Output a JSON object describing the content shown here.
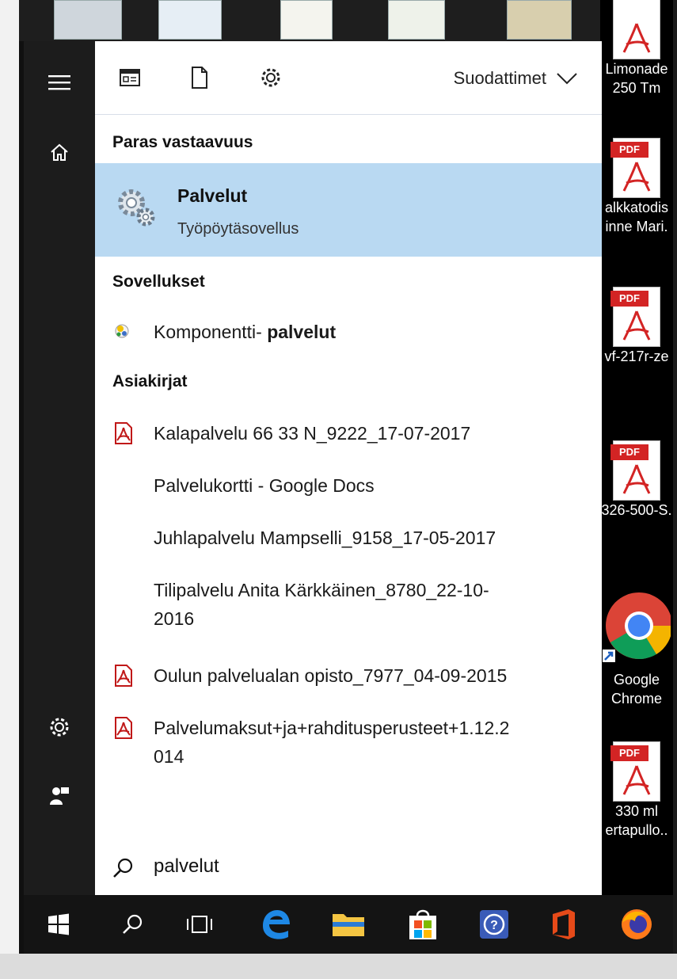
{
  "toolbar": {
    "filters_label": "Suodattimet"
  },
  "best_match": {
    "heading": "Paras vastaavuus",
    "title": "Palvelut",
    "subtitle": "Työpöytäsovellus"
  },
  "apps": {
    "heading": "Sovellukset",
    "item_prefix": "Komponentti-",
    "item_bold": "palvelut"
  },
  "documents": {
    "heading": "Asiakirjat",
    "items": [
      {
        "line1": "Kalapalvelu 66 33 N_9222_17-07-2017",
        "line2": "",
        "icon": "pdf-icon"
      },
      {
        "line1": "Palvelukortti - Google Docs",
        "line2": "",
        "icon": ""
      },
      {
        "line1": "Juhlapalvelu Mampselli_9158_17-05-2017",
        "line2": "",
        "icon": ""
      },
      {
        "line1": "Tilipalvelu Anita Kärkkäinen_8780_22-10-",
        "line2": "2016",
        "icon": ""
      },
      {
        "line1": "Oulun palvelualan opisto_7977_04-09-2015",
        "line2": "",
        "icon": "pdf-icon"
      },
      {
        "line1": "Palvelumaksut+ja+rahditusperusteet+1.12.2",
        "line2": "014",
        "icon": "pdf-icon"
      }
    ]
  },
  "search": {
    "query": "palvelut"
  },
  "desktop_icons": {
    "pdf_tag": "PDF",
    "items": [
      {
        "line1": "Limonade",
        "line2": "250 Tm"
      },
      {
        "line1": "alkkatodis",
        "line2": "inne Mari."
      },
      {
        "line1": "vf-217r-ze",
        "line2": ""
      },
      {
        "line1": "326-500-S.",
        "line2": ""
      },
      {
        "line1": "Google",
        "line2": "Chrome"
      },
      {
        "line1": "330 ml",
        "line2": "ertapullo.."
      }
    ]
  },
  "colors": {
    "accent": "#b9d9f2",
    "sidebar": "#1c1c1c",
    "taskbar": "#141414",
    "pdf_red": "#d32424"
  }
}
